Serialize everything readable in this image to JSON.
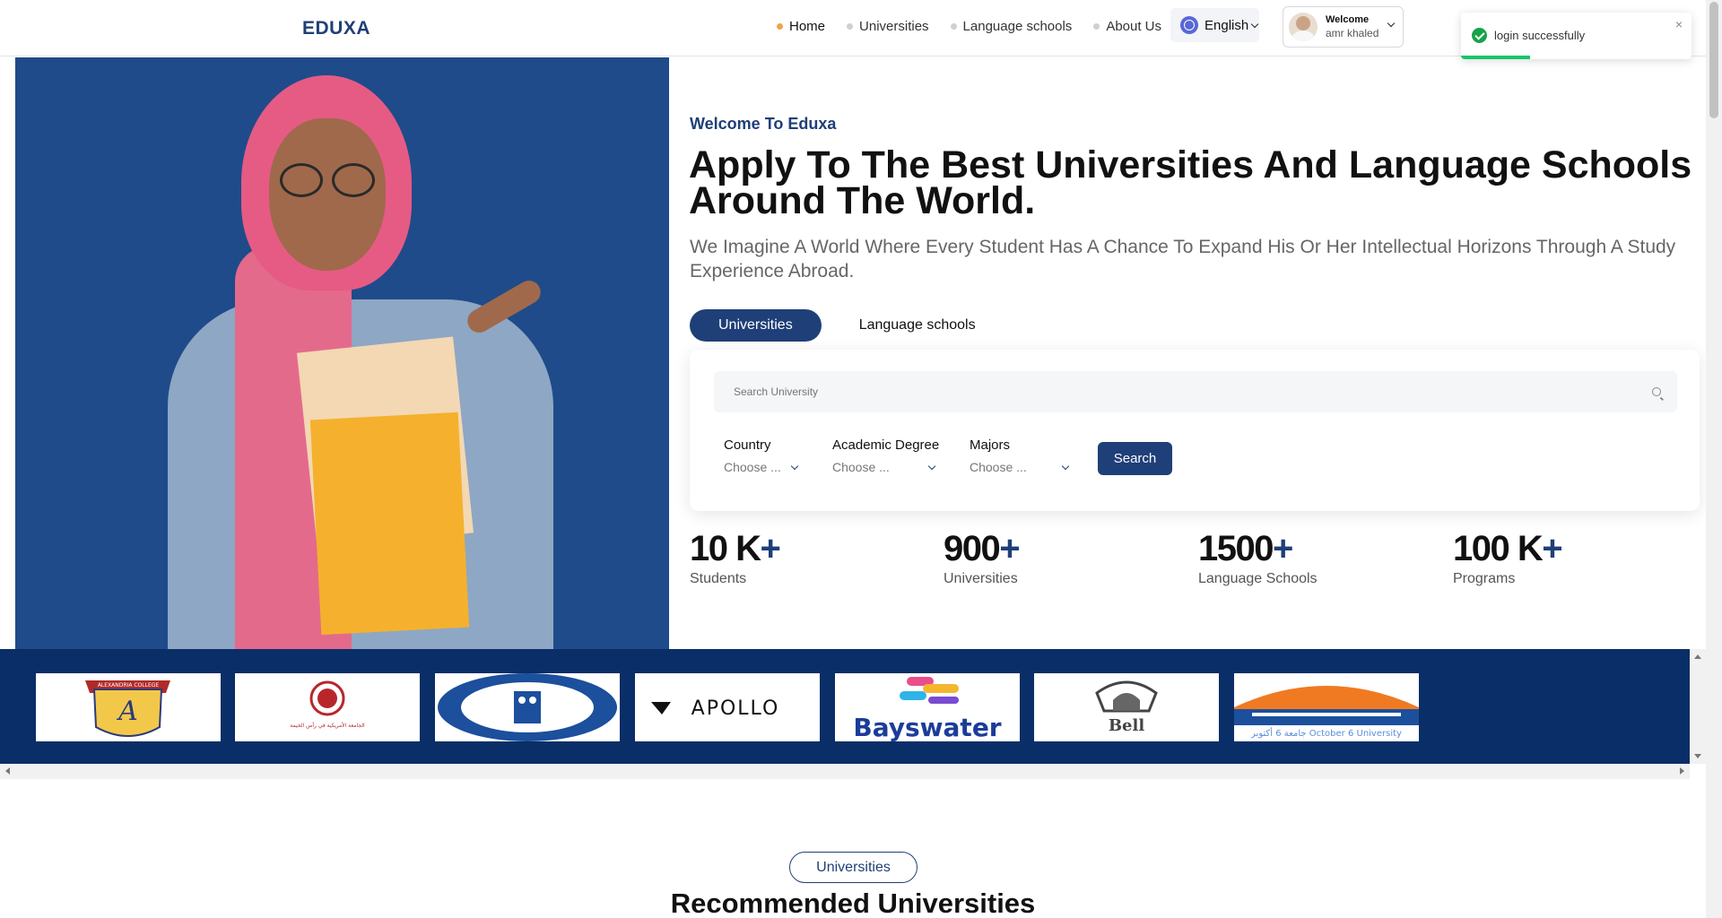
{
  "header": {
    "logo": "EDUXA",
    "nav": [
      {
        "label": "Home",
        "active": true
      },
      {
        "label": "Universities",
        "active": false
      },
      {
        "label": "Language schools",
        "active": false
      },
      {
        "label": "About Us",
        "active": false
      }
    ],
    "language": "English",
    "user": {
      "welcome": "Welcome",
      "name": "amr khaled"
    }
  },
  "toast": {
    "message": "login successfully",
    "close": "×",
    "progress": 0.3,
    "color": "#16a34a"
  },
  "hero": {
    "welcome": "Welcome To Eduxa",
    "title": "Apply To The Best Universities And Language Schools Around The World.",
    "subtitle": "We Imagine A World Where Every Student Has A Chance To Expand His Or Her Intellectual Horizons Through A Study Experience Abroad.",
    "tabs": [
      {
        "label": "Universities",
        "active": true
      },
      {
        "label": "Language schools",
        "active": false
      }
    ],
    "search": {
      "placeholder": "Search University",
      "filters": [
        {
          "label": "Country",
          "value": "Choose ..."
        },
        {
          "label": "Academic Degree",
          "value": "Choose ..."
        },
        {
          "label": "Majors",
          "value": "Choose ..."
        }
      ],
      "button": "Search"
    },
    "stats": [
      {
        "number": "10 K",
        "plus": "+",
        "label": "Students"
      },
      {
        "number": "900",
        "plus": "+",
        "label": "Universities"
      },
      {
        "number": "1500",
        "plus": "+",
        "label": "Language Schools"
      },
      {
        "number": "100 K",
        "plus": "+",
        "label": "Programs"
      }
    ]
  },
  "partners": [
    {
      "name": "ALEXANDRIA COLLEGE"
    },
    {
      "name": "الجامعة الأمريكية في رأس الخيمة"
    },
    {
      "name": "owl-logo"
    },
    {
      "name": "APOLLO"
    },
    {
      "name": "Bayswater"
    },
    {
      "name": "Bell"
    },
    {
      "name": "جامعة 6 أكتوبر October 6 University"
    }
  ],
  "section": {
    "pill": "Universities",
    "title": "Recommended Universities"
  },
  "colors": {
    "brand": "#1f3f78",
    "accent": "#f0a34a",
    "strip": "#0a2e67"
  }
}
